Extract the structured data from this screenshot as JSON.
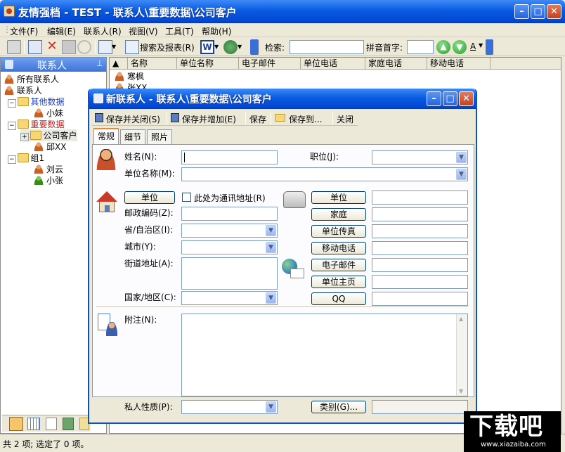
{
  "app": {
    "title": "友情强档 - TEST - 联系人\\重要数据\\公司客户"
  },
  "menu": [
    "文件(F)",
    "编辑(E)",
    "联系人(R)",
    "视图(V)",
    "工具(T)",
    "帮助(H)"
  ],
  "toolbar": {
    "search_report": "搜索及报表(R)",
    "search_label": "检索:",
    "pinyin_label": "拼音首字:",
    "font_label": "A"
  },
  "left_pane": {
    "title": "联系人",
    "tree": [
      "所有联系人",
      "联系人",
      "其他数据",
      "小妹",
      "重要数据",
      "公司客户",
      "邱XX",
      "组1",
      "刘云",
      "小张"
    ]
  },
  "list": {
    "columns": [
      "名称",
      "单位名称",
      "电子邮件",
      "单位电话",
      "家庭电话",
      "移动电话"
    ],
    "rows": [
      {
        "name": "寒枫"
      },
      {
        "name": "张XX"
      }
    ]
  },
  "status": {
    "text": "共 2 项; 选定了 0 项。"
  },
  "dialog": {
    "title": "新联系人 - 联系人\\重要数据\\公司客户",
    "toolbar": [
      "保存并关闭(S)",
      "保存并增加(E)",
      "保存",
      "保存到...",
      "关闭"
    ],
    "tabs": [
      "常规",
      "细节",
      "照片"
    ],
    "fields": {
      "name": "姓名(N):",
      "position": "职位(J):",
      "company": "单位名称(M):",
      "address_btn": "单位",
      "mailing_chk": "此处为通讯地址(R)",
      "zip": "邮政编码(Z):",
      "province": "省/自治区(I):",
      "city": "城市(Y):",
      "street": "街道地址(A):",
      "country": "国家/地区(C):",
      "notes": "附注(N):",
      "privacy": "私人性质(P):",
      "category_btn": "类别(G)..."
    },
    "phone_buttons": [
      "单位",
      "家庭",
      "单位传真",
      "移动电话",
      "电子邮件",
      "单位主页",
      "QQ"
    ]
  },
  "watermark": {
    "big": "下载吧",
    "small": "www.xiazaiba.com"
  }
}
